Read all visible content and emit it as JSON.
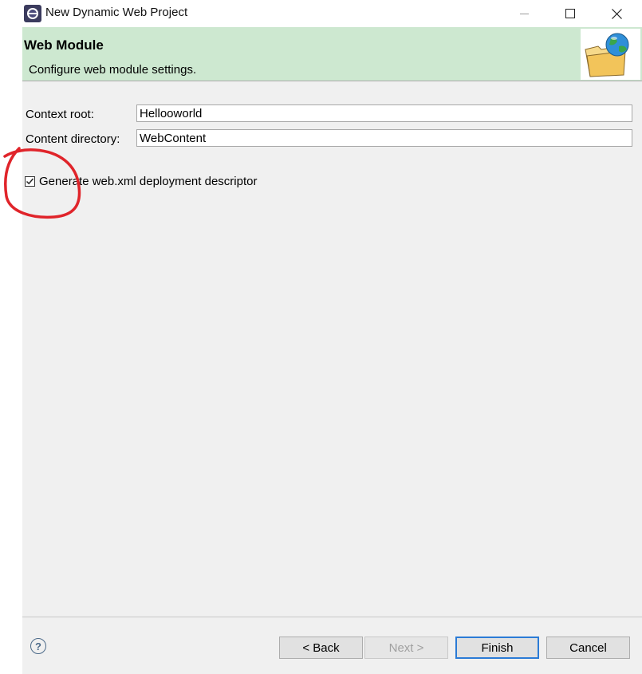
{
  "window": {
    "title": "New Dynamic Web Project",
    "app_icon": "eclipse-icon",
    "controls": [
      "minimize-icon",
      "maximize-icon",
      "close-icon"
    ]
  },
  "banner": {
    "title": "Web Module",
    "description": "Configure web module settings.",
    "icon": "web-folder-globe-icon",
    "background": "#cde8d0"
  },
  "form": {
    "context_root_label": "Context root:",
    "context_root_value": "Hellooworld",
    "content_dir_label": "Content directory:",
    "content_dir_value": "WebContent",
    "generate_descriptor_label": "Generate web.xml deployment descriptor",
    "generate_descriptor_checked": true
  },
  "buttons": {
    "help_icon": "help-icon",
    "back_label": "< Back",
    "next_label": "Next >",
    "finish_label": "Finish",
    "cancel_label": "Cancel"
  },
  "colors": {
    "annotation_red": "#e0242a",
    "default_button_border": "#2b7bd6"
  }
}
